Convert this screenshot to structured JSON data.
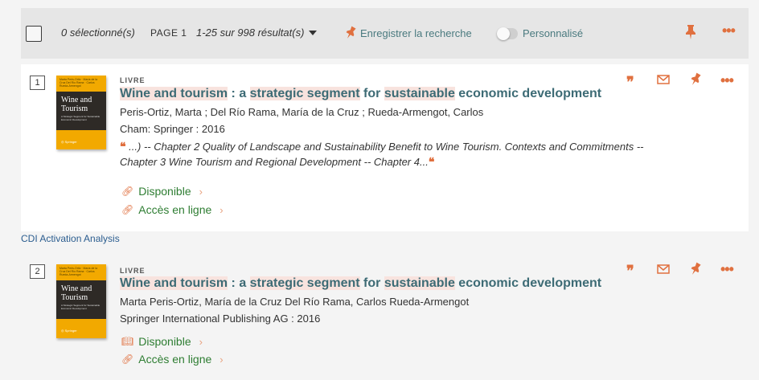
{
  "results_bar": {
    "selected": "0 sélectionné(s)",
    "page": "PAGE 1",
    "range": "1-25 sur 998 résultat(s)",
    "save_search": "Enregistrer la recherche",
    "personalized": "Personnalisé",
    "toggle_on": false
  },
  "results": [
    {
      "number": "1",
      "type": "LIVRE",
      "title_parts": [
        "Wine and tourism",
        " : a ",
        "strategic segment",
        " for ",
        "sustainable",
        " economic development"
      ],
      "authors": "Peris-Ortiz, Marta ; Del Río Rama, María de la Cruz ; Rueda-Armengot, Carlos",
      "publisher": "Cham: Springer : 2016",
      "snippet_1": "...) -- Chapter 2 Quality of Landscape and Sustainability Benefit to Wine Tourism. Contexts and Commitments --",
      "snippet_2": "Chapter 3 Wine Tourism and Regional Development -- Chapter 4...",
      "availability": "Disponible",
      "online_access": "Accès en ligne",
      "cover_title": "Wine and Tourism"
    },
    {
      "number": "2",
      "type": "LIVRE",
      "title_parts": [
        "Wine and tourism",
        " : a ",
        "strategic segment",
        " for ",
        "sustainable",
        " economic development"
      ],
      "authors": "Marta Peris-Ortiz, María de la Cruz Del Río Rama, Carlos Rueda-Armengot",
      "publisher": "Springer International Publishing AG : 2016",
      "availability": "Disponible",
      "online_access": "Accès en ligne",
      "cover_title": "Wine and Tourism"
    }
  ],
  "cdi_link": "CDI Activation Analysis",
  "colors": {
    "accent": "#e0703f",
    "title": "#3d6b75",
    "available": "#2e7d32",
    "highlight": "#f8e3de"
  },
  "icons": [
    "checkbox-icon",
    "caret-down-icon",
    "pin-icon",
    "more-icon",
    "quote-icon",
    "mail-icon",
    "link-icon",
    "book-icon",
    "chevron-right-icon"
  ]
}
